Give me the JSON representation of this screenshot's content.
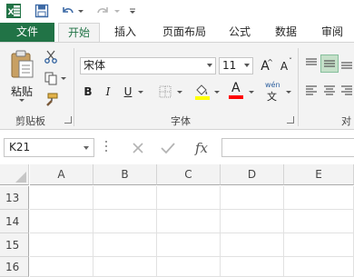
{
  "qat": {
    "icons": [
      "excel-logo-icon",
      "save-icon",
      "undo-icon",
      "redo-icon",
      "customize-qat-icon"
    ]
  },
  "tabs": [
    {
      "label": "文件",
      "name": "tab-file"
    },
    {
      "label": "开始",
      "name": "tab-home"
    },
    {
      "label": "插入",
      "name": "tab-insert"
    },
    {
      "label": "页面布局",
      "name": "tab-page-layout"
    },
    {
      "label": "公式",
      "name": "tab-formulas"
    },
    {
      "label": "数据",
      "name": "tab-data"
    },
    {
      "label": "审阅",
      "name": "tab-review"
    }
  ],
  "clipboard": {
    "paste_label": "粘贴",
    "group_label": "剪贴板"
  },
  "font": {
    "family": "宋体",
    "size": "11",
    "grow_label": "A",
    "shrink_label": "A",
    "bold_label": "B",
    "italic_label": "I",
    "underline_label": "U",
    "font_color_label": "A",
    "phonetic_label": "wén",
    "group_label": "字体"
  },
  "alignment": {
    "group_label_partial": "对"
  },
  "formula_bar": {
    "name_box": "K21",
    "fx_label": "fx",
    "formula": ""
  },
  "grid": {
    "columns": [
      "A",
      "B",
      "C",
      "D",
      "E"
    ],
    "rows": [
      "13",
      "14",
      "15",
      "16"
    ]
  },
  "colors": {
    "file_tab": "#217346",
    "highlight_yellow": "#ffff00",
    "font_red": "#ff0000",
    "align_selected": "#c5e0c9"
  }
}
